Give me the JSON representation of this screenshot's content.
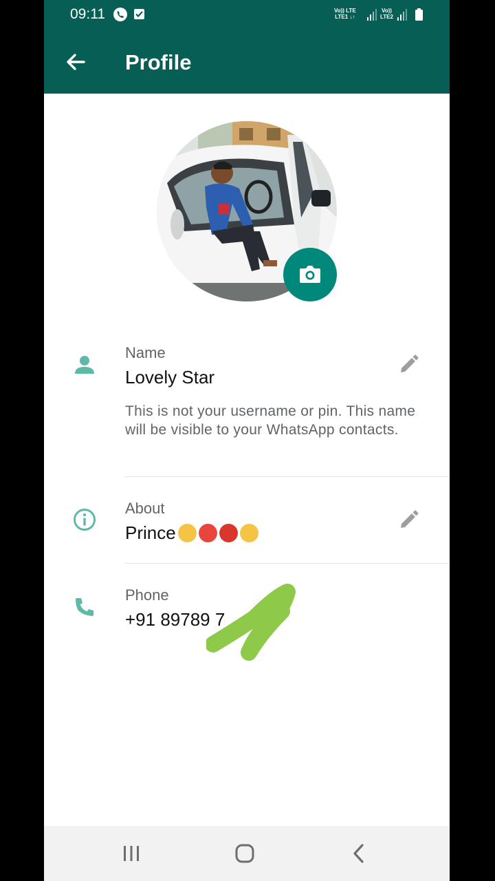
{
  "status_bar": {
    "time": "09:11",
    "sim1_top": "Vo)) LTE",
    "sim1_bottom": "LTE1 ↓↑",
    "sim2_top": "Vo))",
    "sim2_bottom": "LTE2"
  },
  "app_bar": {
    "title": "Profile",
    "back_icon": "arrow-left-icon"
  },
  "profile": {
    "photo_alt": "Profile photo: man sitting in a white car",
    "camera_icon": "camera-icon"
  },
  "name_field": {
    "label": "Name",
    "value": "Lovely Star",
    "hint": "This is not your username or pin. This name will be visible to your WhatsApp contacts.",
    "edit_icon": "pencil-icon"
  },
  "about_field": {
    "label": "About",
    "value": "Prince",
    "emojis": [
      "😤",
      "😡",
      "🤬",
      "🤨"
    ],
    "edit_icon": "pencil-icon"
  },
  "phone_field": {
    "label": "Phone",
    "value": "+91 89789 7"
  },
  "nav_bar": {
    "recents_icon": "recents-icon",
    "home_icon": "home-icon",
    "back_icon": "chevron-left-icon"
  },
  "colors": {
    "header": "#075e54",
    "accent": "#00897b",
    "icon_teal": "#5fb9a8",
    "redaction_scribble": "#8fc94a"
  }
}
